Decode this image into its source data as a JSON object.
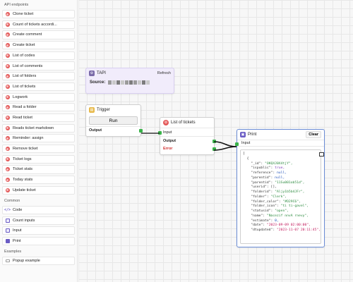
{
  "sidebar": {
    "api_title": "API endpoints",
    "api_items": [
      {
        "label": "Clone ticket"
      },
      {
        "label": "Count of tickets accordi..."
      },
      {
        "label": "Create comment"
      },
      {
        "label": "Create ticket"
      },
      {
        "label": "List of codes"
      },
      {
        "label": "List of comments"
      },
      {
        "label": "List of folders"
      },
      {
        "label": "List of tickets"
      },
      {
        "label": "Logwork"
      },
      {
        "label": "Read a folder"
      },
      {
        "label": "Read ticket"
      },
      {
        "label": "Reads ticket markdown"
      },
      {
        "label": "Reminder: assign"
      },
      {
        "label": "Remove ticket"
      },
      {
        "label": "Ticket logs"
      },
      {
        "label": "Ticket stats"
      },
      {
        "label": "Today stats"
      },
      {
        "label": "Update ticket"
      }
    ],
    "common_title": "Common",
    "common_items": [
      {
        "label": "Code",
        "icon": "code-icon"
      },
      {
        "label": "Count inputs",
        "icon": "box-icon"
      },
      {
        "label": "Input",
        "icon": "box-icon"
      },
      {
        "label": "Print",
        "icon": "print-icon"
      }
    ],
    "examples_title": "Examples",
    "examples_items": [
      {
        "label": "Popup example",
        "icon": "popup-icon"
      }
    ]
  },
  "nodes": {
    "tapi": {
      "title": "TAPI",
      "refresh_label": "Refresh",
      "source_label": "Source:"
    },
    "trigger": {
      "title": "Trigger",
      "run_label": "Run",
      "output_label": "Output"
    },
    "list": {
      "title": "List of tickets",
      "input_label": "Input",
      "output_label": "Output",
      "error_label": "Error"
    },
    "print": {
      "title": "Print",
      "clear_label": "Clear",
      "input_label": "Input"
    }
  },
  "print_output": [
    "[",
    "  {",
    "    \"_id\": \"OKQXJ0X4tjY\",",
    "    \"ispublic\": true,",
    "    \"reference\": null,",
    "    \"parentid\": null,",
    "    \"parentid\": \"11Su001ob51d\",",
    "    \"userid\": [],",
    "    \"folderid\": \"Aljy1b5b4JFr\",",
    "    \"folder\": \"Clerk\",",
    "    \"folder_color\": \"#D29C6\",",
    "    \"folder_icon\": \"ti ti-gavel\",",
    "    \"statusid\": \"open\",",
    "    \"name\": \"Nacezif nnvA rnevy\",",
    "    \"estimate\": 0,",
    "    \"date\": \"2023-09-09 02:00:00\",",
    "    \"dtupdated\": \"2023-11-07 20:11:45\","
  ],
  "colors": {
    "port": "#3ab34a",
    "error": "#d23131",
    "api_icon": "#e45a5a",
    "tapi_bg": "#f1ecfb",
    "print_border": "#6b8dd6"
  }
}
